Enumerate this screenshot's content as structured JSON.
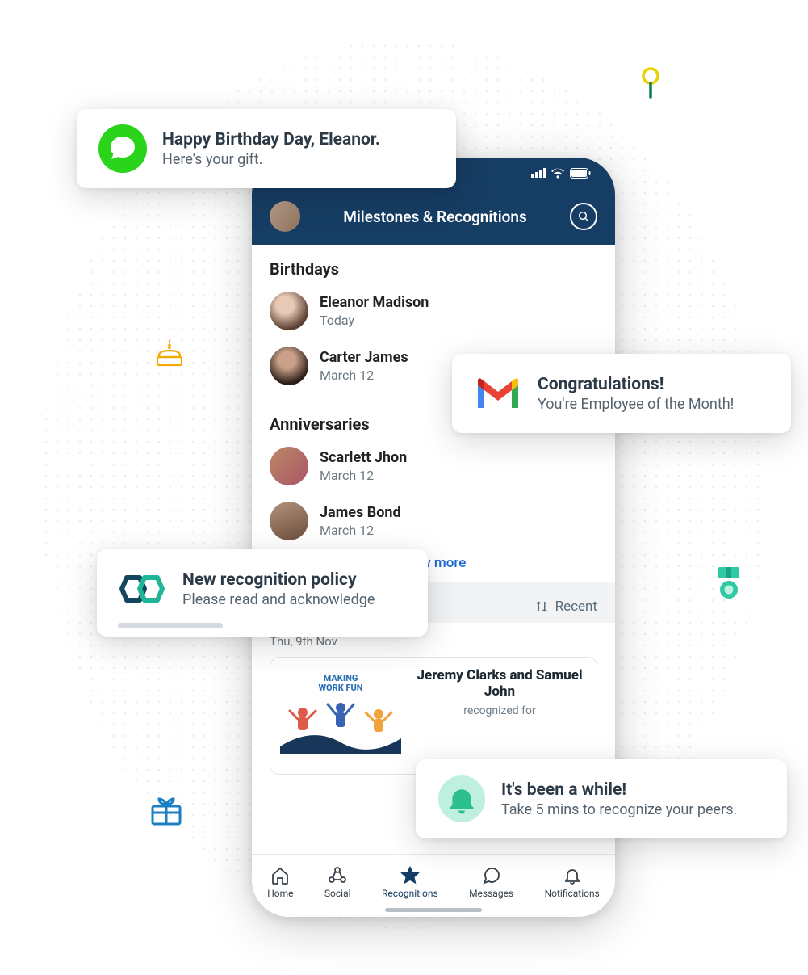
{
  "header": {
    "title": "Milestones & Recognitions"
  },
  "sections": {
    "birthdays": {
      "title": "Birthdays",
      "items": [
        {
          "name": "Eleanor Madison",
          "date": "Today"
        },
        {
          "name": "Carter James",
          "date": "March 12"
        }
      ]
    },
    "anniversaries": {
      "title": "Anniversaries",
      "items": [
        {
          "name": "Scarlett Jhon",
          "date": "March 12"
        },
        {
          "name": "James Bond",
          "date": "March 12"
        }
      ]
    },
    "view_more": "View more",
    "sort_label": "Recent",
    "feed": {
      "date_label": "Thu, 9th Nov",
      "card": {
        "img_caption_line1": "MAKING",
        "img_caption_line2": "WORK FUN",
        "title": "Jeremy Clarks and Samuel John",
        "subtitle": "recognized for"
      }
    }
  },
  "tabs": {
    "home": "Home",
    "social": "Social",
    "recognitions": "Recognitions",
    "messages": "Messages",
    "notifications": "Notifications"
  },
  "notifications": {
    "sms": {
      "title": "Happy Birthday Day, Eleanor.",
      "body": "Here's your gift."
    },
    "gmail": {
      "title": "Congratulations!",
      "body": "You're Employee of the Month!"
    },
    "policy": {
      "title": "New recognition policy",
      "body": "Please read and acknowledge"
    },
    "reminder": {
      "title": "It's been a while!",
      "body": "Take 5 mins to recognize your peers."
    }
  }
}
